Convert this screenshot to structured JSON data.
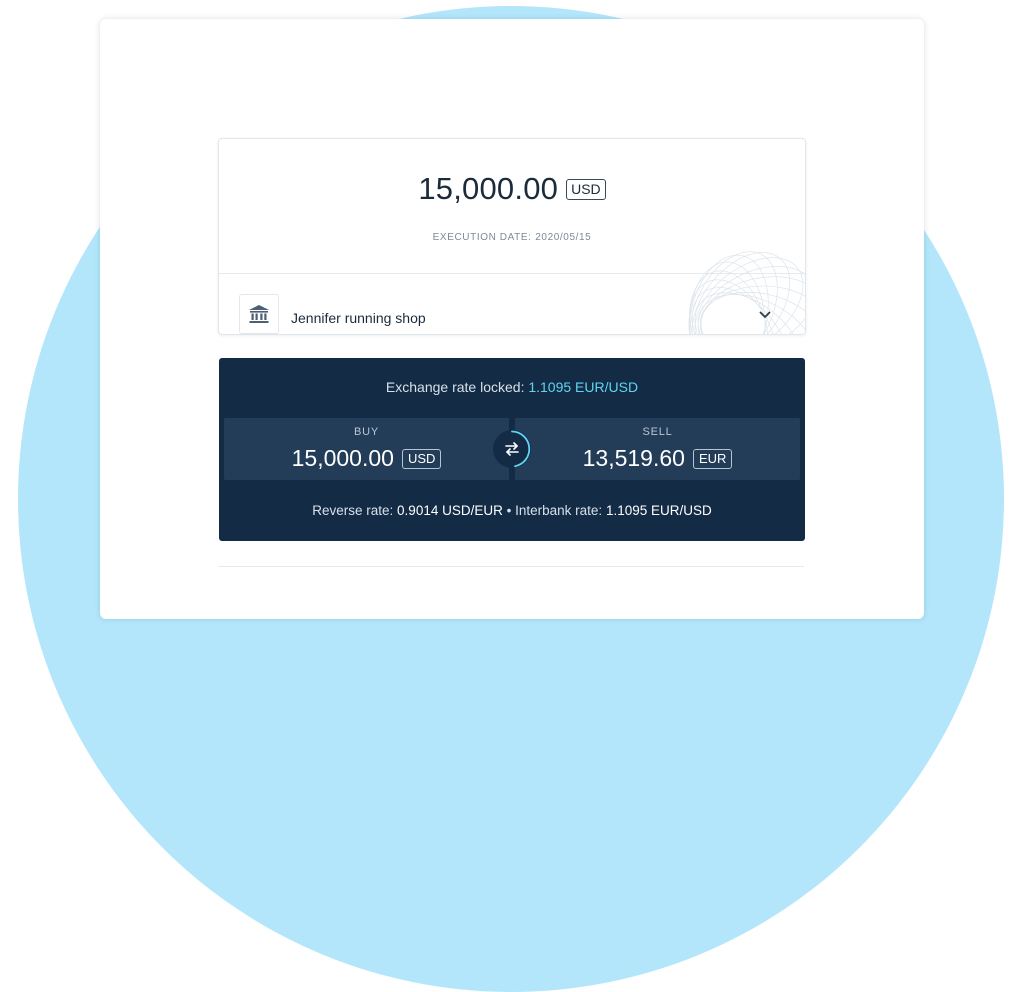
{
  "payment": {
    "amount": "15,000.00",
    "currency": "USD",
    "execution_date_label": "EXECUTION DATE:",
    "execution_date": "2020/05/15",
    "payee_name": "Jennifer running shop"
  },
  "exchange": {
    "rate_locked_label": "Exchange rate locked:",
    "rate_locked_value": "1.1095 EUR/USD",
    "buy_label": "BUY",
    "buy_amount": "15,000.00",
    "buy_currency": "USD",
    "sell_label": "SELL",
    "sell_amount": "13,519.60",
    "sell_currency": "EUR",
    "reverse_rate_label": "Reverse rate:",
    "reverse_rate_value": "0.9014 USD/EUR",
    "separator": "•",
    "interbank_rate_label": "Interbank rate:",
    "interbank_rate_value": "1.1095 EUR/USD"
  },
  "icons": {
    "bank": "bank-icon",
    "expand": "chevron-down-icon",
    "swap": "swap-arrows-icon"
  },
  "colors": {
    "accent": "#5fd5f2",
    "card_dark": "#142b45",
    "trade_box": "#233c58",
    "background_circle": "#b3e6fb"
  }
}
